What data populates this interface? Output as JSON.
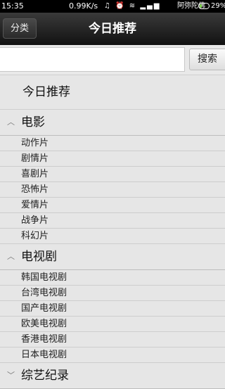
{
  "status": {
    "time": "15:35",
    "speed": "0.99K/s",
    "icons": "♫ ⏰ ≋ ▂▄▆",
    "carrier": "阿弥陀佛",
    "battery_pct": "29%",
    "battery_level": 0.29
  },
  "titlebar": {
    "category_label": "分类",
    "title": "今日推荐"
  },
  "search": {
    "placeholder": "",
    "button_label": "搜索"
  },
  "list": {
    "today_label": "今日推荐",
    "groups": [
      {
        "label": "电影",
        "arrow": "^",
        "items": [
          "动作片",
          "剧情片",
          "喜剧片",
          "恐怖片",
          "爱情片",
          "战争片",
          "科幻片"
        ]
      },
      {
        "label": "电视剧",
        "arrow": "^",
        "items": [
          "韩国电视剧",
          "台湾电视剧",
          "国产电视剧",
          "欧美电视剧",
          "香港电视剧",
          "日本电视剧"
        ]
      },
      {
        "label": "综艺纪录",
        "arrow": "v",
        "items": []
      }
    ]
  }
}
